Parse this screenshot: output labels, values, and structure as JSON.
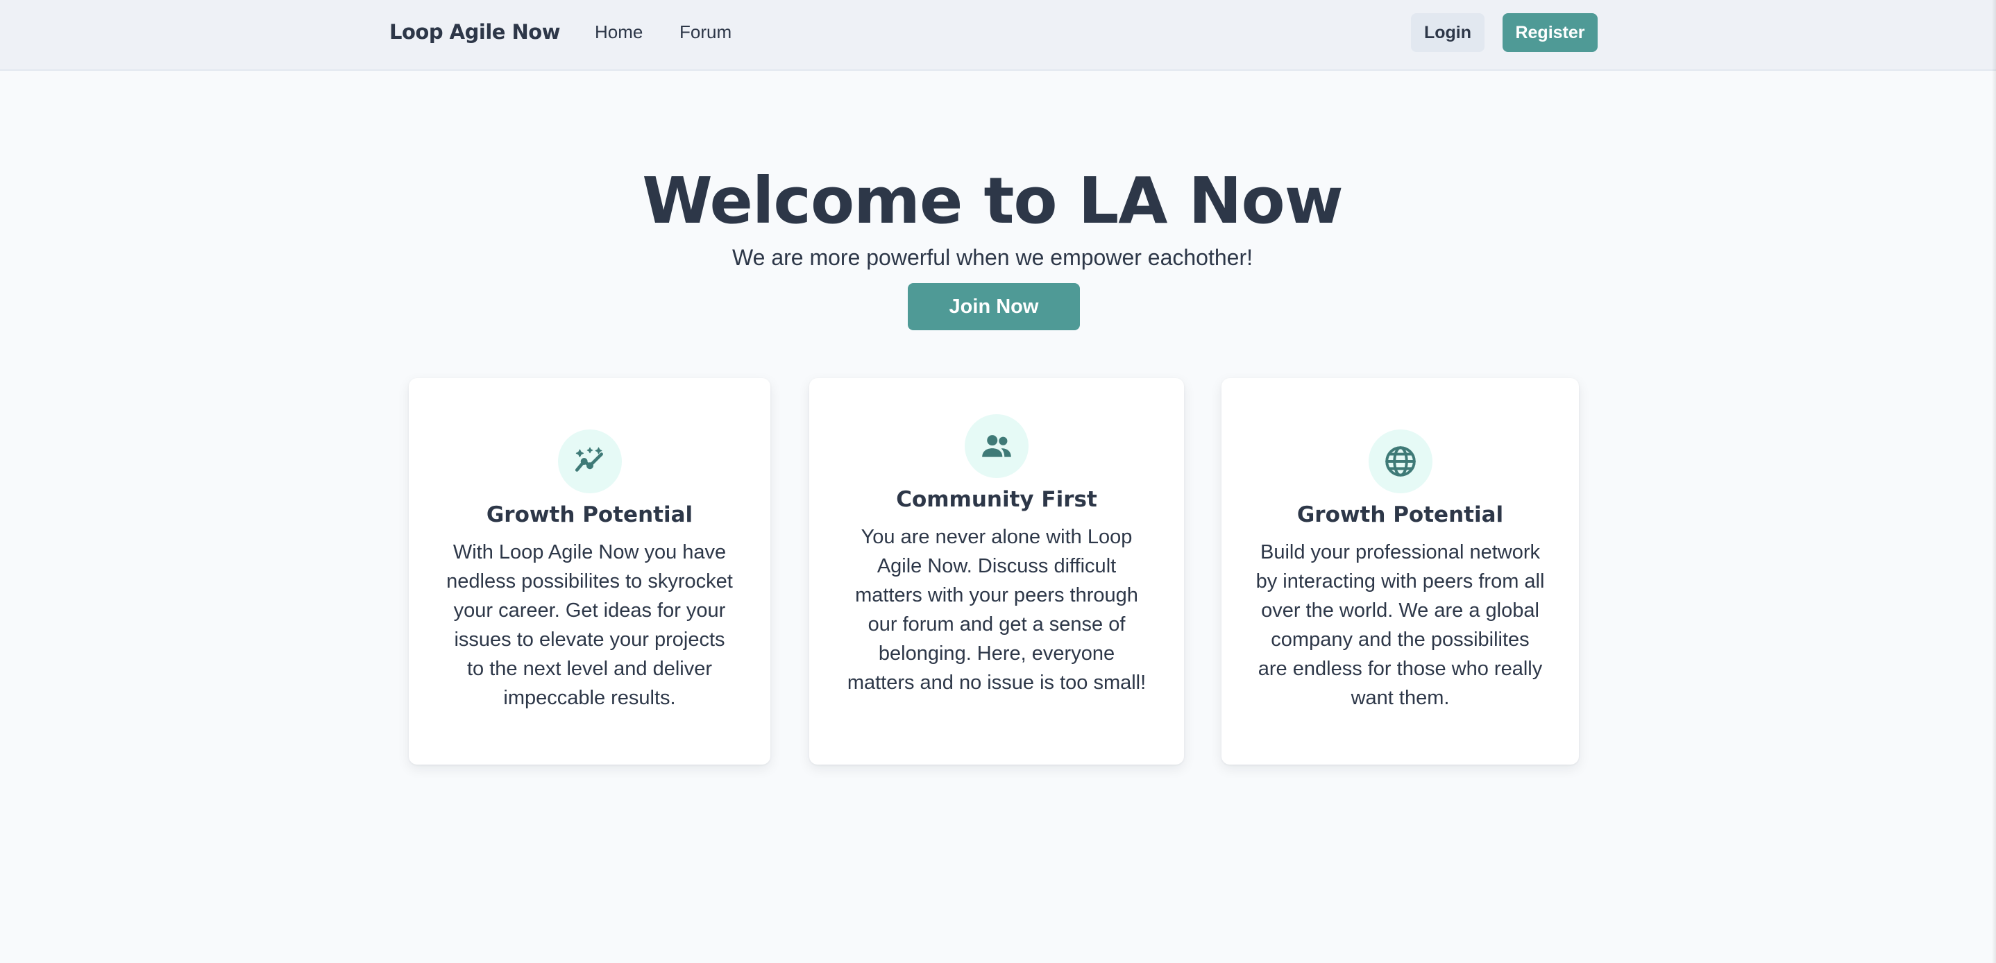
{
  "navbar": {
    "brand": "Loop Agile Now",
    "links": [
      {
        "label": "Home"
      },
      {
        "label": "Forum"
      }
    ],
    "login_label": "Login",
    "register_label": "Register"
  },
  "hero": {
    "title": "Welcome to LA Now",
    "subtitle": "We are more powerful when we empower eachother!",
    "cta_label": "Join Now"
  },
  "features": [
    {
      "icon": "sparkle-chart-icon",
      "title": "Growth Potential",
      "text": "With Loop Agile Now you have nedless possibilites to skyrocket your career. Get ideas for your issues to elevate your projects to the next level and deliver impeccable results."
    },
    {
      "icon": "users-icon",
      "title": "Community First",
      "text": "You are never alone with Loop Agile Now. Discuss difficult matters with your peers through our forum and get a sense of belonging. Here, everyone matters and no issue is too small!"
    },
    {
      "icon": "globe-icon",
      "title": "Growth Potential",
      "text": "Build your professional network by interacting with peers from all over the world. We are a global company and the possibilites are endless for those who really want them."
    }
  ],
  "colors": {
    "accent": "#4f9a96",
    "icon_bg": "#e6faf6",
    "icon_fg": "#3f7a77",
    "text": "#2d3748",
    "navbar_bg": "#eef1f6",
    "page_bg": "#f8fafc"
  }
}
